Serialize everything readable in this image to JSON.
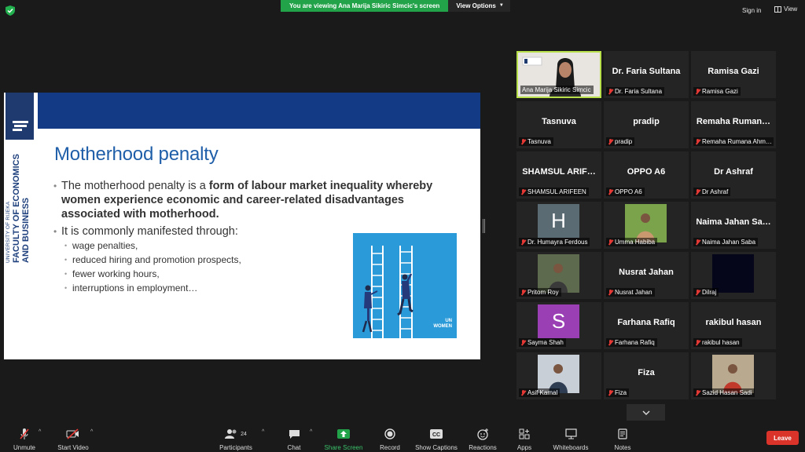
{
  "topbar": {
    "viewing_text": "You are viewing Ana Marija Sikiric Simcic's screen",
    "view_options": "View Options",
    "sign_in": "Sign in",
    "view": "View"
  },
  "slide": {
    "university": "UNIVERSITY OF RIJEKA",
    "faculty_line1": "FACULTY OF ECONOMICS",
    "faculty_line2": "AND BUSINESS",
    "title": "Motherhood penalty",
    "bullet1_normal": "The motherhood penalty is a ",
    "bullet1_bold": "form of labour market inequality whereby women experience economic and career-related disadvantages associated with motherhood.",
    "bullet2": "It is commonly manifested through:",
    "subbullets": [
      "wage penalties,",
      "reduced hiring and promotion prospects,",
      "fewer working hours,",
      "interruptions in employment…"
    ],
    "image_brand_line1": "UN",
    "image_brand_line2": "WOMEN"
  },
  "gallery": [
    {
      "name": "Ana Marija Sikiric Simcic",
      "big": "",
      "type": "video-host"
    },
    {
      "name": "Dr. Faria Sultana",
      "big": "Dr. Faria Sultana",
      "type": "name"
    },
    {
      "name": "Ramisa Gazi",
      "big": "Ramisa Gazi",
      "type": "name"
    },
    {
      "name": "Tasnuva",
      "big": "Tasnuva",
      "type": "name"
    },
    {
      "name": "pradip",
      "big": "pradip",
      "type": "name"
    },
    {
      "name": "Remaha Rumana Ahm…",
      "big": "Remaha Ruman…",
      "type": "name"
    },
    {
      "name": "SHAMSUL ARIFEEN",
      "big": "SHAMSUL ARIF…",
      "type": "name"
    },
    {
      "name": "OPPO A6",
      "big": "OPPO A6",
      "type": "name"
    },
    {
      "name": "Dr Ashraf",
      "big": "Dr Ashraf",
      "type": "name"
    },
    {
      "name": "Dr. Humayra Ferdous",
      "big": "H",
      "type": "avatar",
      "color": "#5a6b73"
    },
    {
      "name": "Umma Habiba",
      "big": "",
      "type": "photo-outdoor"
    },
    {
      "name": "Naima Jahan Saba",
      "big": "Naima Jahan Sa…",
      "type": "name"
    },
    {
      "name": "Pritom Roy",
      "big": "",
      "type": "photo-street"
    },
    {
      "name": "Nusrat Jahan",
      "big": "Nusrat Jahan",
      "type": "name"
    },
    {
      "name": "Dilraj",
      "big": "",
      "type": "photo-dark"
    },
    {
      "name": "Sayma Shah",
      "big": "S",
      "type": "avatar",
      "color": "#9b3fb5"
    },
    {
      "name": "Farhana Rafiq",
      "big": "Farhana Rafiq",
      "type": "name"
    },
    {
      "name": "rakibul hasan",
      "big": "rakibul hasan",
      "type": "name"
    },
    {
      "name": "Asif Kamal",
      "big": "",
      "type": "photo-person"
    },
    {
      "name": "Fiza",
      "big": "Fiza",
      "type": "name"
    },
    {
      "name": "Sazid Hasan Sadi",
      "big": "",
      "type": "photo-red"
    }
  ],
  "toolbar": {
    "unmute": "Unmute",
    "start_video": "Start Video",
    "participants": "Participants",
    "participant_count": "24",
    "chat": "Chat",
    "share_screen": "Share Screen",
    "record": "Record",
    "show_captions": "Show Captions",
    "reactions": "Reactions",
    "apps": "Apps",
    "whiteboards": "Whiteboards",
    "notes": "Notes",
    "leave": "Leave"
  },
  "colors": {
    "share_green": "#22a34a",
    "leave_red": "#d9332a",
    "active_speaker": "#b8e04a",
    "slide_blue": "#123a85"
  }
}
